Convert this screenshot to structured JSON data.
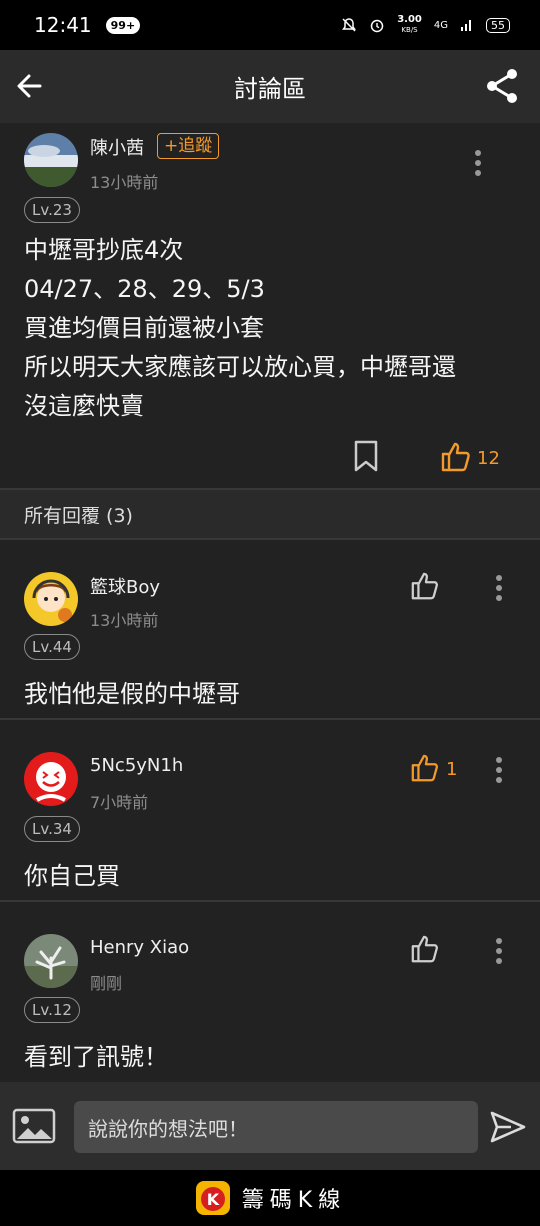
{
  "status_bar": {
    "time": "12:41",
    "notif_badge": "99+",
    "net_speed": "3.00",
    "net_unit": "KB/S",
    "network": "4G",
    "battery": "55"
  },
  "app_bar": {
    "title": "討論區",
    "back_icon": "arrow-left-icon",
    "share_icon": "share-icon"
  },
  "post": {
    "author": "陳小茜",
    "follow_label": "+追蹤",
    "time": "13小時前",
    "level": "Lv.23",
    "lines": [
      "中壢哥抄底4次",
      "04/27、28、29、5/3",
      "買進均價目前還被小套",
      "所以明天大家應該可以放心買，中壢哥還",
      "沒這麼快賣"
    ],
    "like_count": "12"
  },
  "replies_header": "所有回覆 (3)",
  "replies": [
    {
      "author": "籃球Boy",
      "time": "13小時前",
      "level": "Lv.44",
      "text": "我怕他是假的中壢哥",
      "like_count": "",
      "liked": false
    },
    {
      "author": "5Nc5yN1h",
      "time": "7小時前",
      "level": "Lv.34",
      "text": "你自己買",
      "like_count": "1",
      "liked": true
    },
    {
      "author": "Henry Xiao",
      "time": "剛剛",
      "level": "Lv.12",
      "text": "看到了訊號！",
      "like_count": "",
      "liked": false
    }
  ],
  "composer": {
    "placeholder": "說說你的想法吧！"
  },
  "brand": {
    "name": "籌碼K線",
    "logo_letter": "K"
  },
  "colors": {
    "accent": "#f39a2a",
    "background": "#222222",
    "header": "#2b2b2b"
  }
}
